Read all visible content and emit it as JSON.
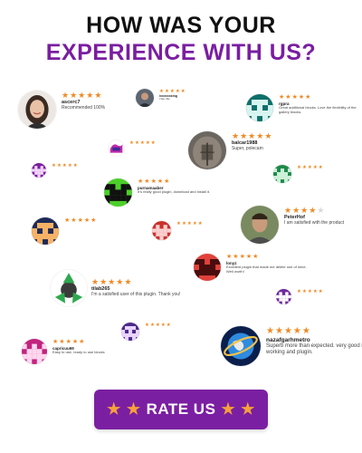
{
  "headline": {
    "line1": "HOW WAS YOUR",
    "line2": "EXPERIENCE WITH US?"
  },
  "colors": {
    "accent": "#7a1ea1",
    "star": "#f08a24",
    "button": "#7b1fa2",
    "button_star": "#f6a13a"
  },
  "star_glyph": "★",
  "reviews": [
    {
      "name": "ascerc7",
      "text": "Recommended 100%",
      "rating": 5,
      "avatar": "woman-photo-avatar"
    },
    {
      "name": "ixxxxxxxing",
      "text": "I like this",
      "rating": 5,
      "avatar": "person-photo-avatar"
    },
    {
      "name": "rgpra",
      "text": "Great additional blocks. Love the flexibility of the gallery blocks.",
      "rating": 5,
      "avatar": "teal-pixel-avatar"
    },
    {
      "name": "",
      "text": "",
      "rating": 5,
      "avatar": "logo-avatar"
    },
    {
      "name": "balcar1988",
      "text": "Super, polecam",
      "rating": 5,
      "avatar": "muscle-photo-avatar"
    },
    {
      "name": "",
      "text": "",
      "rating": 5,
      "avatar": "purple-pixel-avatar"
    },
    {
      "name": "",
      "text": "",
      "rating": 5,
      "avatar": "green-pixel-avatar"
    },
    {
      "name": "purnamaaber",
      "text": "It's really good plugin, download and install it.",
      "rating": 5,
      "avatar": "green-robot-avatar"
    },
    {
      "name": "",
      "text": "",
      "rating": 5,
      "avatar": "navy-pixel-avatar"
    },
    {
      "name": "",
      "text": "",
      "rating": 5,
      "avatar": "red-pixel-avatar"
    },
    {
      "name": "PeterHof",
      "text": "I am satisfied with the product",
      "rating": 4,
      "avatar": "man-photo-avatar"
    },
    {
      "name": "lonyz",
      "text": "Excellent plugin that made me delete one of mine. Well worth!",
      "rating": 5,
      "avatar": "red-robot-avatar"
    },
    {
      "name": "",
      "text": "",
      "rating": 5,
      "avatar": "recycle-avatar"
    },
    {
      "name": "tilab265",
      "text": "I'm a satisfied user of this plugin. Thank you!",
      "rating": 5,
      "avatar": "recycle-avatar"
    },
    {
      "name": "",
      "text": "",
      "rating": 5,
      "avatar": "purple-pattern-avatar"
    },
    {
      "name": "",
      "text": "",
      "rating": 5,
      "avatar": "purple-small-avatar"
    },
    {
      "name": "capricuu69",
      "text": "Easy to use, ready to use blocks",
      "rating": 5,
      "avatar": "magenta-pixel-avatar"
    },
    {
      "name": "nazafgarhmetro",
      "text": "Superb more than expected. very good in working and plugin.",
      "rating": 5,
      "avatar": "globe-avatar"
    }
  ],
  "cta": {
    "label": "RATE US",
    "star": "★"
  }
}
